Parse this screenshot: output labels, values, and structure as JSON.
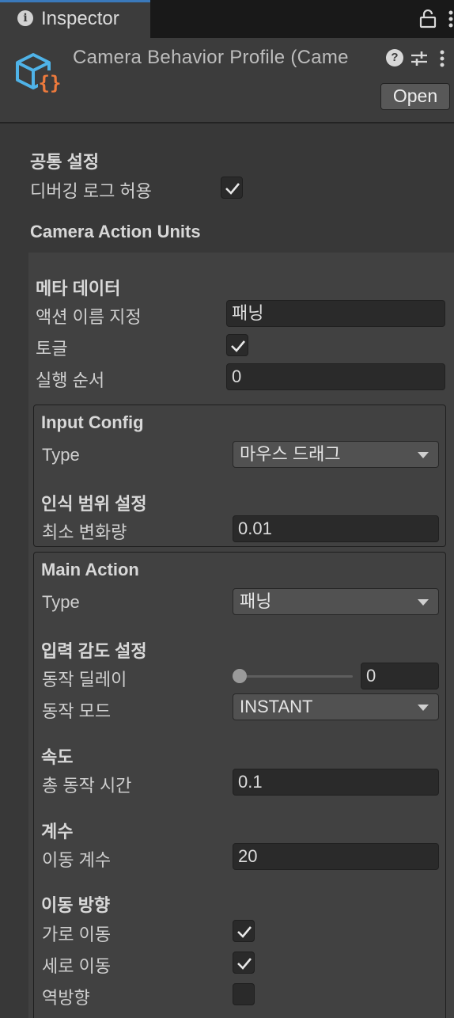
{
  "tab": {
    "title": "Inspector",
    "info_icon": "info-icon",
    "lock_icon": "lock-icon",
    "more_icon": "kebab-icon"
  },
  "header": {
    "title": "Camera Behavior Profile (Came",
    "asset_icon": "scriptable-object-icon",
    "help_icon_glyph": "?",
    "settings_icon": "sliders-icon",
    "more_icon": "kebab-icon",
    "open_label": "Open"
  },
  "common": {
    "title": "공통 설정",
    "debug_log_label": "디버깅 로그 허용",
    "debug_log_checked": true
  },
  "units_title": "Camera Action Units",
  "meta": {
    "title": "메타 데이터",
    "action_name_label": "액션 이름 지정",
    "action_name_value": "패닝",
    "toggle_label": "토글",
    "toggle_checked": true,
    "order_label": "실행 순서",
    "order_value": "0"
  },
  "input_config": {
    "title": "Input Config",
    "type_label": "Type",
    "type_value": "마우스 드래그",
    "range_title": "인식 범위 설정",
    "min_change_label": "최소 변화량",
    "min_change_value": "0.01"
  },
  "main_action": {
    "title": "Main Action",
    "type_label": "Type",
    "type_value": "패닝",
    "sensitivity_title": "입력 감도 설정",
    "delay_label": "동작 딜레이",
    "delay_value": "0",
    "delay_slider_fraction": 0,
    "mode_label": "동작 모드",
    "mode_value": "INSTANT",
    "speed_title": "속도",
    "duration_label": "총 동작 시간",
    "duration_value": "0.1",
    "coef_title": "계수",
    "move_coef_label": "이동 계수",
    "move_coef_value": "20",
    "direction_title": "이동 방향",
    "horizontal_label": "가로 이동",
    "horizontal_checked": true,
    "vertical_label": "세로 이동",
    "vertical_checked": true,
    "reverse_label": "역방향",
    "reverse_checked": false
  },
  "colors": {
    "accent": "#3a79bb",
    "background": "#383838",
    "panel": "#414141",
    "asset_icon_blue": "#4fb3e8",
    "asset_icon_orange": "#ee7a3c"
  }
}
